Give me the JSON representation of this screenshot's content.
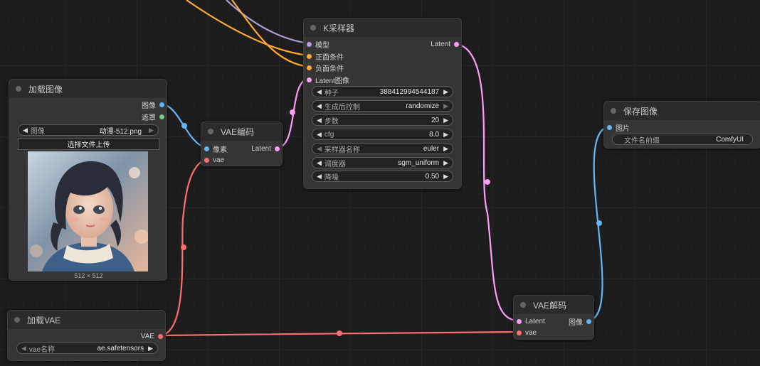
{
  "colors": {
    "model": "#b39ddb",
    "conditioning": "#ffa931",
    "latent": "#ff9cf9",
    "image": "#64b5f6",
    "mask": "#81c784",
    "vae": "#ff6e6e"
  },
  "load_image": {
    "title": "加载图像",
    "outputs": [
      "图像",
      "遮罩"
    ],
    "image_label": "图像",
    "image_value": "动漫-512.png",
    "upload_label": "选择文件上传",
    "size_caption": "512 × 512"
  },
  "vae_encode": {
    "title": "VAE编码",
    "inputs": [
      "像素",
      "vae"
    ],
    "output": "Latent"
  },
  "ksampler": {
    "title": "K采样器",
    "inputs": [
      "模型",
      "正面条件",
      "负面条件",
      "Latent图像"
    ],
    "output": "Latent",
    "widgets": [
      {
        "label": "种子",
        "value": "388412994544187"
      },
      {
        "label": "生成后控制",
        "value": "randomize"
      },
      {
        "label": "步数",
        "value": "20"
      },
      {
        "label": "cfg",
        "value": "8.0"
      },
      {
        "label": "采样器名称",
        "value": "euler"
      },
      {
        "label": "调度器",
        "value": "sgm_uniform"
      },
      {
        "label": "降噪",
        "value": "0.50"
      }
    ]
  },
  "save_image": {
    "title": "保存图像",
    "input": "图片",
    "widget_label": "文件名前缀",
    "widget_value": "ComfyUI"
  },
  "vae_decode": {
    "title": "VAE解码",
    "inputs": [
      "Latent",
      "vae"
    ],
    "output": "图像"
  },
  "load_vae": {
    "title": "加载VAE",
    "output": "VAE",
    "widget_label": "vae名称",
    "widget_value": "ae.safetensors"
  }
}
